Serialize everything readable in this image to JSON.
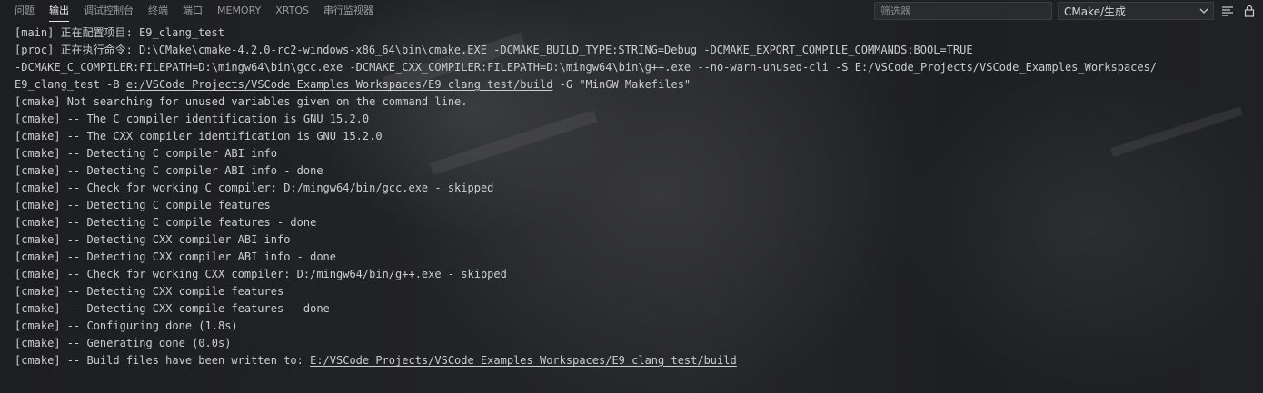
{
  "tabs": [
    {
      "label": "问题"
    },
    {
      "label": "输出",
      "active": true
    },
    {
      "label": "调试控制台"
    },
    {
      "label": "终端"
    },
    {
      "label": "端口"
    },
    {
      "label": "MEMORY"
    },
    {
      "label": "XRTOS"
    },
    {
      "label": "串行监视器"
    }
  ],
  "filter": {
    "placeholder": "筛选器"
  },
  "channel_select": {
    "value": "CMake/生成"
  },
  "icons": {
    "chevron": "chevron-down-icon",
    "list": "list-filter-icon",
    "lock": "lock-icon"
  },
  "output": {
    "lines": [
      "[main] 正在配置项目: E9_clang_test",
      "[proc] 正在执行命令: D:\\CMake\\cmake-4.2.0-rc2-windows-x86_64\\bin\\cmake.EXE -DCMAKE_BUILD_TYPE:STRING=Debug -DCMAKE_EXPORT_COMPILE_COMMANDS:BOOL=TRUE",
      "-DCMAKE_C_COMPILER:FILEPATH=D:\\mingw64\\bin\\gcc.exe -DCMAKE_CXX_COMPILER:FILEPATH=D:\\mingw64\\bin\\g++.exe --no-warn-unused-cli -S E:/VSCode_Projects/VSCode_Examples_Workspaces/",
      {
        "pre": "E9_clang_test -B ",
        "link": "e:/VSCode_Projects/VSCode_Examples_Workspaces/E9_clang_test/build",
        "post": " -G \"MinGW Makefiles\""
      },
      "[cmake] Not searching for unused variables given on the command line.",
      "[cmake] -- The C compiler identification is GNU 15.2.0",
      "[cmake] -- The CXX compiler identification is GNU 15.2.0",
      "[cmake] -- Detecting C compiler ABI info",
      "[cmake] -- Detecting C compiler ABI info - done",
      "[cmake] -- Check for working C compiler: D:/mingw64/bin/gcc.exe - skipped",
      "[cmake] -- Detecting C compile features",
      "[cmake] -- Detecting C compile features - done",
      "[cmake] -- Detecting CXX compiler ABI info",
      "[cmake] -- Detecting CXX compiler ABI info - done",
      "[cmake] -- Check for working CXX compiler: D:/mingw64/bin/g++.exe - skipped",
      "[cmake] -- Detecting CXX compile features",
      "[cmake] -- Detecting CXX compile features - done",
      "[cmake] -- Configuring done (1.8s)",
      "[cmake] -- Generating done (0.0s)",
      {
        "pre": "[cmake] -- Build files have been written to: ",
        "link": "E:/VSCode_Projects/VSCode_Examples_Workspaces/E9_clang_test/build",
        "post": ""
      }
    ]
  }
}
